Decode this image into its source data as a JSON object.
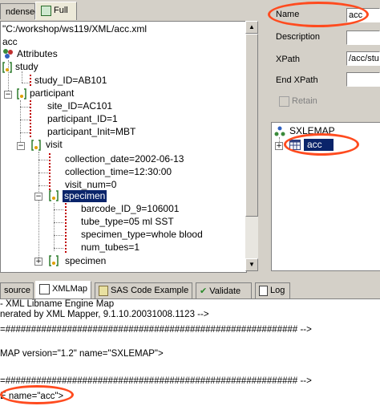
{
  "top_tabs": [
    {
      "label": "ndensed"
    },
    {
      "label": "Full"
    }
  ],
  "tree": {
    "path": "\"C:/workshop/ws119/XML/acc.xml",
    "root": "acc",
    "attributes_label": "Attributes",
    "nodes": {
      "study": "study",
      "study_id": "study_ID=AB101",
      "participant": "participant",
      "site_id": "site_ID=AC101",
      "participant_id": "participant_ID=1",
      "participant_init": "participant_Init=MBT",
      "visit": "visit",
      "collection_date": "collection_date=2002-06-13",
      "collection_time": "collection_time=12:30:00",
      "visit_num": "visit_num=0",
      "specimen": "specimen",
      "barcode": "barcode_ID_9=106001",
      "tube_type": "tube_type=05 ml SST",
      "specimen_type": "specimen_type=whole blood",
      "num_tubes": "num_tubes=1",
      "specimen2": "specimen"
    }
  },
  "properties": {
    "name_label": "Name",
    "name_value": "acc",
    "description_label": "Description",
    "description_value": "",
    "xpath_label": "XPath",
    "xpath_value": "/acc/stu",
    "end_xpath_label": "End XPath",
    "end_xpath_value": "",
    "retain_label": "Retain"
  },
  "map_tree": {
    "root": "SXLEMAP",
    "table": "acc"
  },
  "bottom_tabs": [
    {
      "label": "source"
    },
    {
      "label": "XMLMap"
    },
    {
      "label": "SAS Code Example"
    },
    {
      "label": "Validate"
    },
    {
      "label": "Log"
    }
  ],
  "code_lines": [
    "- XML Libname Engine Map",
    "nerated by XML Mapper, 9.1.10.20031008.1123 -->",
    "=######################################################### -->",
    "MAP version=\"1.2\" name=\"SXLEMAP\">",
    "=######################################################### -->",
    "E name=\"acc\">"
  ],
  "colors": {
    "highlight_oval": "#ff4b1f",
    "selection": "#0a246a",
    "window": "#d4d0c8"
  }
}
